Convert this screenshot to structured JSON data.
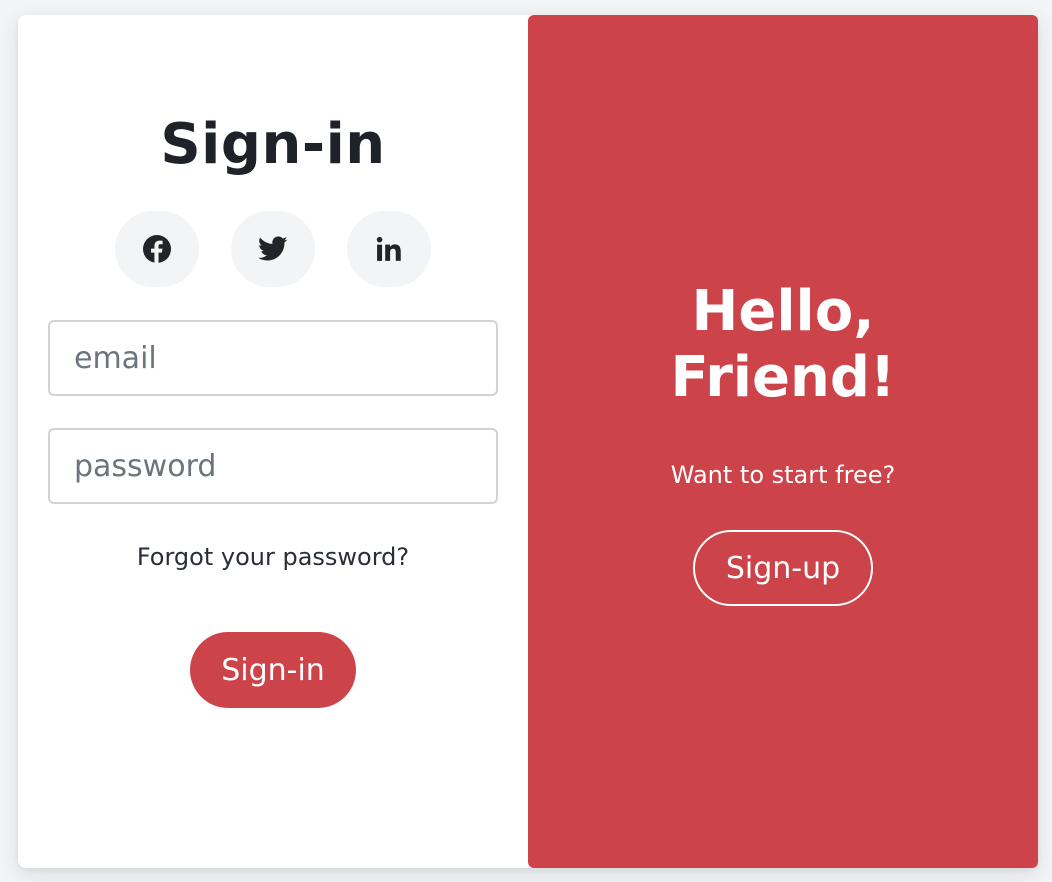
{
  "signin": {
    "title": "Sign-in",
    "socials": [
      {
        "icon": "facebook-icon"
      },
      {
        "icon": "twitter-icon"
      },
      {
        "icon": "linkedin-icon"
      }
    ],
    "email_placeholder": "email",
    "email_value": "",
    "password_placeholder": "password",
    "password_value": "",
    "forgot_label": "Forgot your password?",
    "button_label": "Sign-in"
  },
  "signup": {
    "heading_line1": "Hello,",
    "heading_line2": "Friend!",
    "tagline": "Want to start free?",
    "button_label": "Sign-up"
  },
  "colors": {
    "accent": "#cc434a",
    "text_dark": "#1f2329",
    "social_bg": "#f3f4f6",
    "page_bg": "#f3f4f6"
  }
}
